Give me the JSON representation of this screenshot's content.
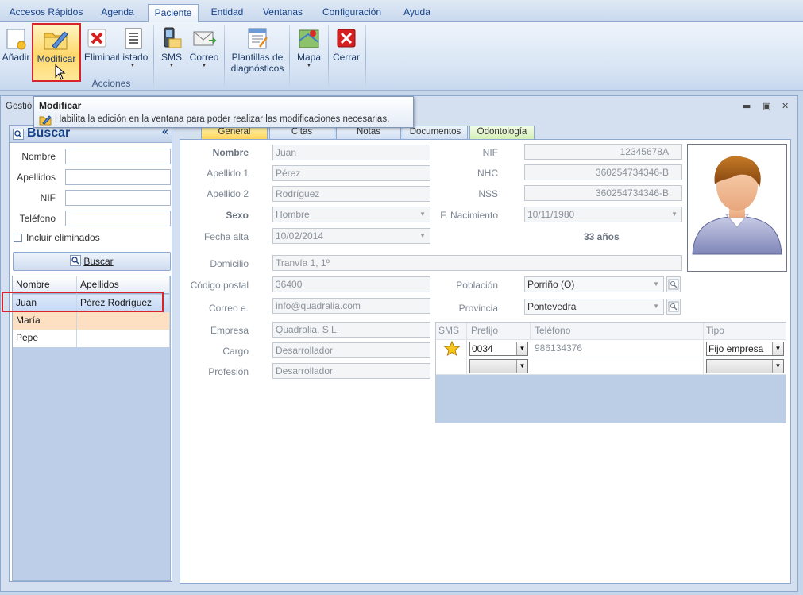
{
  "menu": {
    "tabs": [
      {
        "label": "Accesos Rápidos"
      },
      {
        "label": "Agenda"
      },
      {
        "label": "Paciente"
      },
      {
        "label": "Entidad"
      },
      {
        "label": "Ventanas"
      },
      {
        "label": "Configuración"
      },
      {
        "label": "Ayuda"
      }
    ],
    "active_tab": "Paciente"
  },
  "ribbon": {
    "add_label": "Añadir",
    "modify_label": "Modificar",
    "delete_label": "Eliminar",
    "list_label": "Listado",
    "sms_label": "SMS",
    "mail_label": "Correo",
    "templates_label_1": "Plantillas de",
    "templates_label_2": "diagnósticos",
    "map_label": "Mapa",
    "close_label": "Cerrar",
    "group_label": "Acciones"
  },
  "tooltip": {
    "title": "Modificar",
    "text": "Habilita la edición en la ventana para poder realizar las modificaciones necesarias."
  },
  "window": {
    "title": "Gestió"
  },
  "search": {
    "title": "Buscar",
    "collapse": "«",
    "name_label": "Nombre",
    "surname_label": "Apellidos",
    "nif_label": "NIF",
    "phone_label": "Teléfono",
    "include_deleted_label": "Incluir eliminados",
    "search_button": "Buscar",
    "results": {
      "col_name": "Nombre",
      "col_surname": "Apellidos",
      "rows": [
        {
          "name": "Juan",
          "surname": "Pérez Rodríguez"
        },
        {
          "name": "María",
          "surname": ""
        },
        {
          "name": "Pepe",
          "surname": ""
        }
      ]
    }
  },
  "form": {
    "tabs": [
      "General",
      "Citas",
      "Notas",
      "Documentos",
      "Odontología"
    ],
    "labels": {
      "nombre": "Nombre",
      "apellido1": "Apellido 1",
      "apellido2": "Apellido 2",
      "sexo": "Sexo",
      "fecha_alta": "Fecha alta",
      "domicilio": "Domicilio",
      "codigo_postal": "Código postal",
      "correo": "Correo e.",
      "empresa": "Empresa",
      "cargo": "Cargo",
      "profesion": "Profesión",
      "nif": "NIF",
      "nhc": "NHC",
      "nss": "NSS",
      "f_nacimiento": "F. Nacimiento",
      "poblacion": "Población",
      "provincia": "Provincia"
    },
    "values": {
      "nombre": "Juan",
      "apellido1": "Pérez",
      "apellido2": "Rodríguez",
      "sexo": "Hombre",
      "fecha_alta": "10/02/2014",
      "domicilio": "Tranvía 1, 1º",
      "codigo_postal": "36400",
      "correo": "info@quadralia.com",
      "empresa": "Quadralia, S.L.",
      "cargo": "Desarrollador",
      "profesion": "Desarrollador",
      "nif": "12345678A",
      "nhc": "360254734346-B",
      "nss": "360254734346-B",
      "f_nacimiento": "10/11/1980",
      "edad": "33 años",
      "poblacion": "Porriño (O)",
      "provincia": "Pontevedra"
    },
    "phones": {
      "col_sms": "SMS",
      "col_prefix": "Prefijo",
      "col_phone": "Teléfono",
      "col_type": "Tipo",
      "rows": [
        {
          "prefix": "0034",
          "phone": "986134376",
          "type": "Fijo empresa"
        }
      ]
    }
  },
  "colors": {
    "accent": "#15428b",
    "highlight": "#d9232b",
    "selected_row": "#c4d8f4",
    "alt_row": "#fde0c2"
  }
}
